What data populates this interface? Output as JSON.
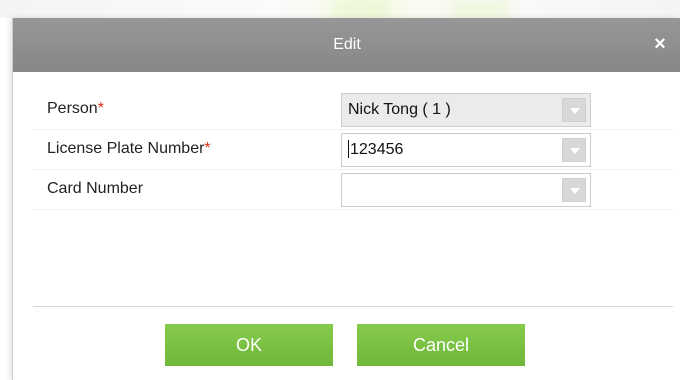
{
  "dialog": {
    "title": "Edit",
    "close_icon": "close-icon"
  },
  "form": {
    "person": {
      "label": "Person",
      "required_mark": "*",
      "value": "Nick Tong ( 1 )"
    },
    "license_plate": {
      "label": "License Plate Number",
      "required_mark": "*",
      "value": "123456"
    },
    "card_number": {
      "label": "Card Number",
      "value": ""
    }
  },
  "buttons": {
    "ok_label": "OK",
    "cancel_label": "Cancel"
  },
  "colors": {
    "titlebar": "#8e8e8e",
    "button": "#7ac143",
    "required": "#e0301e"
  }
}
